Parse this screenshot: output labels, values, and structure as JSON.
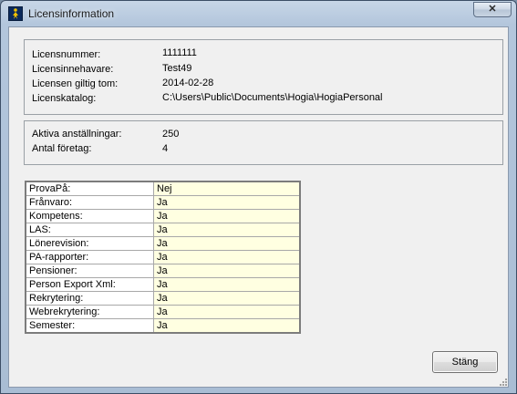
{
  "window": {
    "title": "Licensinformation",
    "close_glyph": "✕"
  },
  "license": {
    "number_label": "Licensnummer:",
    "number_value": "1111111",
    "holder_label": "Licensinnehavare:",
    "holder_value": "Test49",
    "valid_label": "Licensen giltig tom:",
    "valid_value": "2014-02-28",
    "catalog_label": "Licenskatalog:",
    "catalog_value": "C:\\Users\\Public\\Documents\\Hogia\\HogiaPersonal"
  },
  "counts": {
    "employments_label": "Aktiva anställningar:",
    "employments_value": "250",
    "companies_label": "Antal företag:",
    "companies_value": "4"
  },
  "features": [
    {
      "label": "ProvaPå:",
      "value": "Nej"
    },
    {
      "label": "Frånvaro:",
      "value": "Ja"
    },
    {
      "label": "Kompetens:",
      "value": "Ja"
    },
    {
      "label": "LAS:",
      "value": "Ja"
    },
    {
      "label": "Lönerevision:",
      "value": "Ja"
    },
    {
      "label": "PA-rapporter:",
      "value": "Ja"
    },
    {
      "label": "Pensioner:",
      "value": "Ja"
    },
    {
      "label": "Person Export Xml:",
      "value": "Ja"
    },
    {
      "label": "Rekrytering:",
      "value": "Ja"
    },
    {
      "label": "Webrekrytering:",
      "value": "Ja"
    },
    {
      "label": "Semester:",
      "value": "Ja"
    }
  ],
  "buttons": {
    "close_label": "Stäng"
  },
  "colors": {
    "value_cell_bg": "#ffffe1",
    "titlebar": "#b3c6dc",
    "client_bg": "#f0f0f0"
  },
  "icons": {
    "app": "hogia-app-icon",
    "close": "close-icon",
    "grip": "resize-grip-icon"
  }
}
